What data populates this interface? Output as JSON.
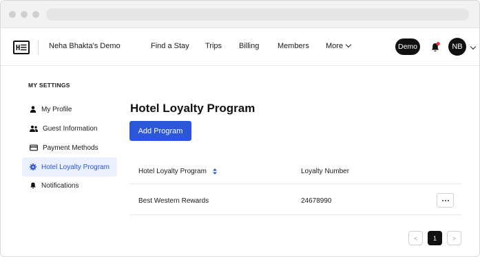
{
  "topnav": {
    "logo_text": "H☰",
    "org_name": "Neha Bhakta's Demo",
    "links": [
      "Find a Stay",
      "Trips",
      "Billing",
      "Members",
      "More"
    ],
    "demo_badge": "Demo",
    "avatar_initials": "NB",
    "notification_dot_color": "#e5363b"
  },
  "sidebar": {
    "heading": "MY SETTINGS",
    "items": [
      {
        "label": "My Profile",
        "icon": "person-icon"
      },
      {
        "label": "Guest Information",
        "icon": "people-icon"
      },
      {
        "label": "Payment Methods",
        "icon": "credit-card-icon"
      },
      {
        "label": "Hotel Loyalty Program",
        "icon": "gear-icon",
        "active": true
      },
      {
        "label": "Notifications",
        "icon": "bell-icon"
      }
    ]
  },
  "main": {
    "title": "Hotel Loyalty Program",
    "add_button": "Add Program",
    "table": {
      "columns": [
        "Hotel Loyalty Program",
        "Loyalty Number"
      ],
      "rows": [
        {
          "program": "Best Western Rewards",
          "number": "24678990"
        }
      ]
    },
    "pagination": {
      "current": "1",
      "prev": "<",
      "next": ">"
    }
  },
  "colors": {
    "accent": "#2c57d8",
    "active_bg": "#eaf0fd"
  }
}
